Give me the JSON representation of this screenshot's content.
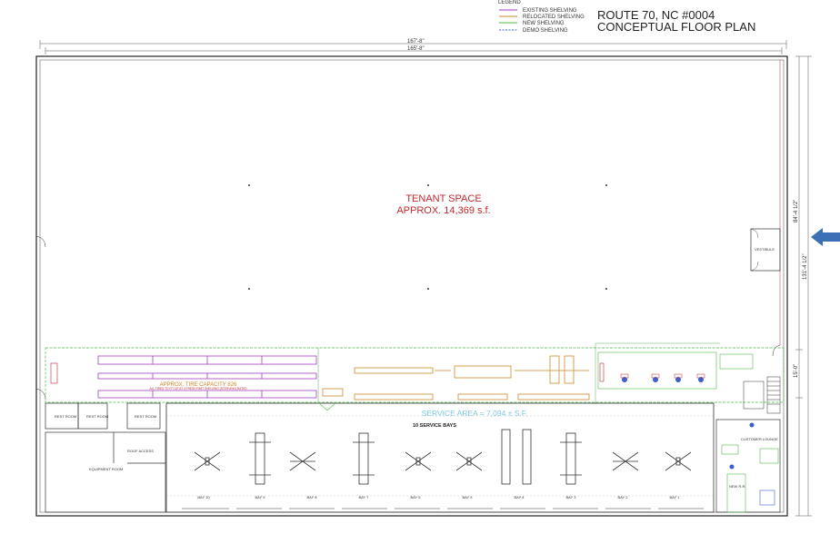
{
  "legend": {
    "heading": "LEGEND",
    "items": [
      {
        "label": "EXISTING SHELVING",
        "color": "#a23fc4"
      },
      {
        "label": "RELOCATED SHELVING",
        "color": "#c98a2a"
      },
      {
        "label": "NEW SHELVING",
        "color": "#4fb848"
      },
      {
        "label": "DEMO SHELVING",
        "color": "#3b5fd0"
      }
    ]
  },
  "title": {
    "line1": "ROUTE 70, NC  #0004",
    "line2": "CONCEPTUAL FLOOR PLAN"
  },
  "dimensions": {
    "overall_width": "167'-8\"",
    "inner_width": "165'-8\"",
    "right_upper": "84'-4 1/2\"",
    "right_total": "131'-4 1/2\"",
    "right_lower": "15'-0\""
  },
  "tenant": {
    "name": "TENANT SPACE",
    "area": "APPROX. 14,369 s.f.",
    "color": "#c0282d"
  },
  "service": {
    "area": "SERVICE AREA = 7,094 ± S.F.",
    "bays_count": "10 SERVICE BAYS",
    "color": "#7ec8e3"
  },
  "tires": {
    "capacity": "APPROX. TIRE CAPACITY 826",
    "note": "ALL TIRES TO FIT 18\" AT 4 FRESH RIMT SHELVING (STERVING) RATED"
  },
  "rooms": {
    "rest1": "REST ROOM",
    "rest2": "REST ROOM",
    "rest3": "REST ROOM",
    "roof_access": "ROOF ACCESS",
    "equipment": "EQUIPMENT ROOM",
    "vestibule": "VESTIBULE",
    "customer_lounge": "CUSTOMER LOUNGE",
    "new_rr": "NEW R.R."
  },
  "bays": [
    "BAY 10",
    "BAY 9",
    "BAY 8",
    "BAY 7",
    "BAY 6",
    "BAY 5",
    "BAY 4",
    "BAY 3",
    "BAY 2",
    "BAY 1"
  ],
  "entry_arrow_color": "#3b6fb6"
}
